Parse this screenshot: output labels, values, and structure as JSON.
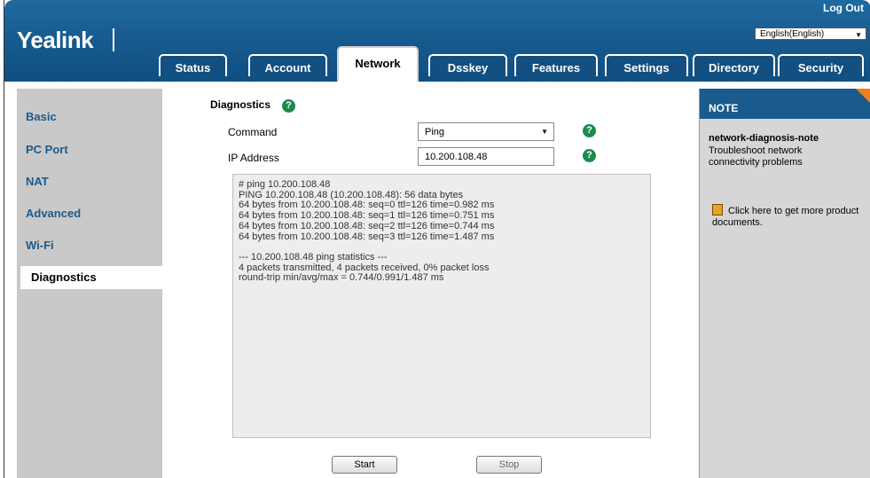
{
  "header": {
    "logo_text": "Yealink",
    "logout_label": "Log Out",
    "language_selected": "English(English)"
  },
  "tabs": [
    {
      "label": "Status"
    },
    {
      "label": "Account"
    },
    {
      "label": "Network",
      "active": true
    },
    {
      "label": "Dsskey"
    },
    {
      "label": "Features"
    },
    {
      "label": "Settings"
    },
    {
      "label": "Directory"
    },
    {
      "label": "Security"
    }
  ],
  "sidebar": {
    "items": [
      {
        "label": "Basic"
      },
      {
        "label": "PC Port"
      },
      {
        "label": "NAT"
      },
      {
        "label": "Advanced"
      },
      {
        "label": "Wi-Fi"
      },
      {
        "label": "Diagnostics",
        "active": true
      }
    ]
  },
  "main": {
    "section_title": "Diagnostics",
    "command_label": "Command",
    "command_value": "Ping",
    "ip_label": "IP Address",
    "ip_value": "10.200.108.48",
    "output": "# ping 10.200.108.48\nPING 10.200.108.48 (10.200.108.48): 56 data bytes\n64 bytes from 10.200.108.48: seq=0 ttl=126 time=0.982 ms\n64 bytes from 10.200.108.48: seq=1 ttl=126 time=0.751 ms\n64 bytes from 10.200.108.48: seq=2 ttl=126 time=0.744 ms\n64 bytes from 10.200.108.48: seq=3 ttl=126 time=1.487 ms\n\n--- 10.200.108.48 ping statistics ---\n4 packets transmitted, 4 packets received, 0% packet loss\nround-trip min/avg/max = 0.744/0.991/1.487 ms",
    "start_label": "Start",
    "stop_label": "Stop"
  },
  "note": {
    "title": "NOTE",
    "heading": "network-diagnosis-note",
    "body": "Troubleshoot network connectivity problems",
    "doc_link": "Click here to get more product documents."
  },
  "colors": {
    "header_blue": "#16598c",
    "nav_text": "#1d5a8a",
    "help_green": "#1c8a4e",
    "note_corner": "#f07e1a"
  }
}
